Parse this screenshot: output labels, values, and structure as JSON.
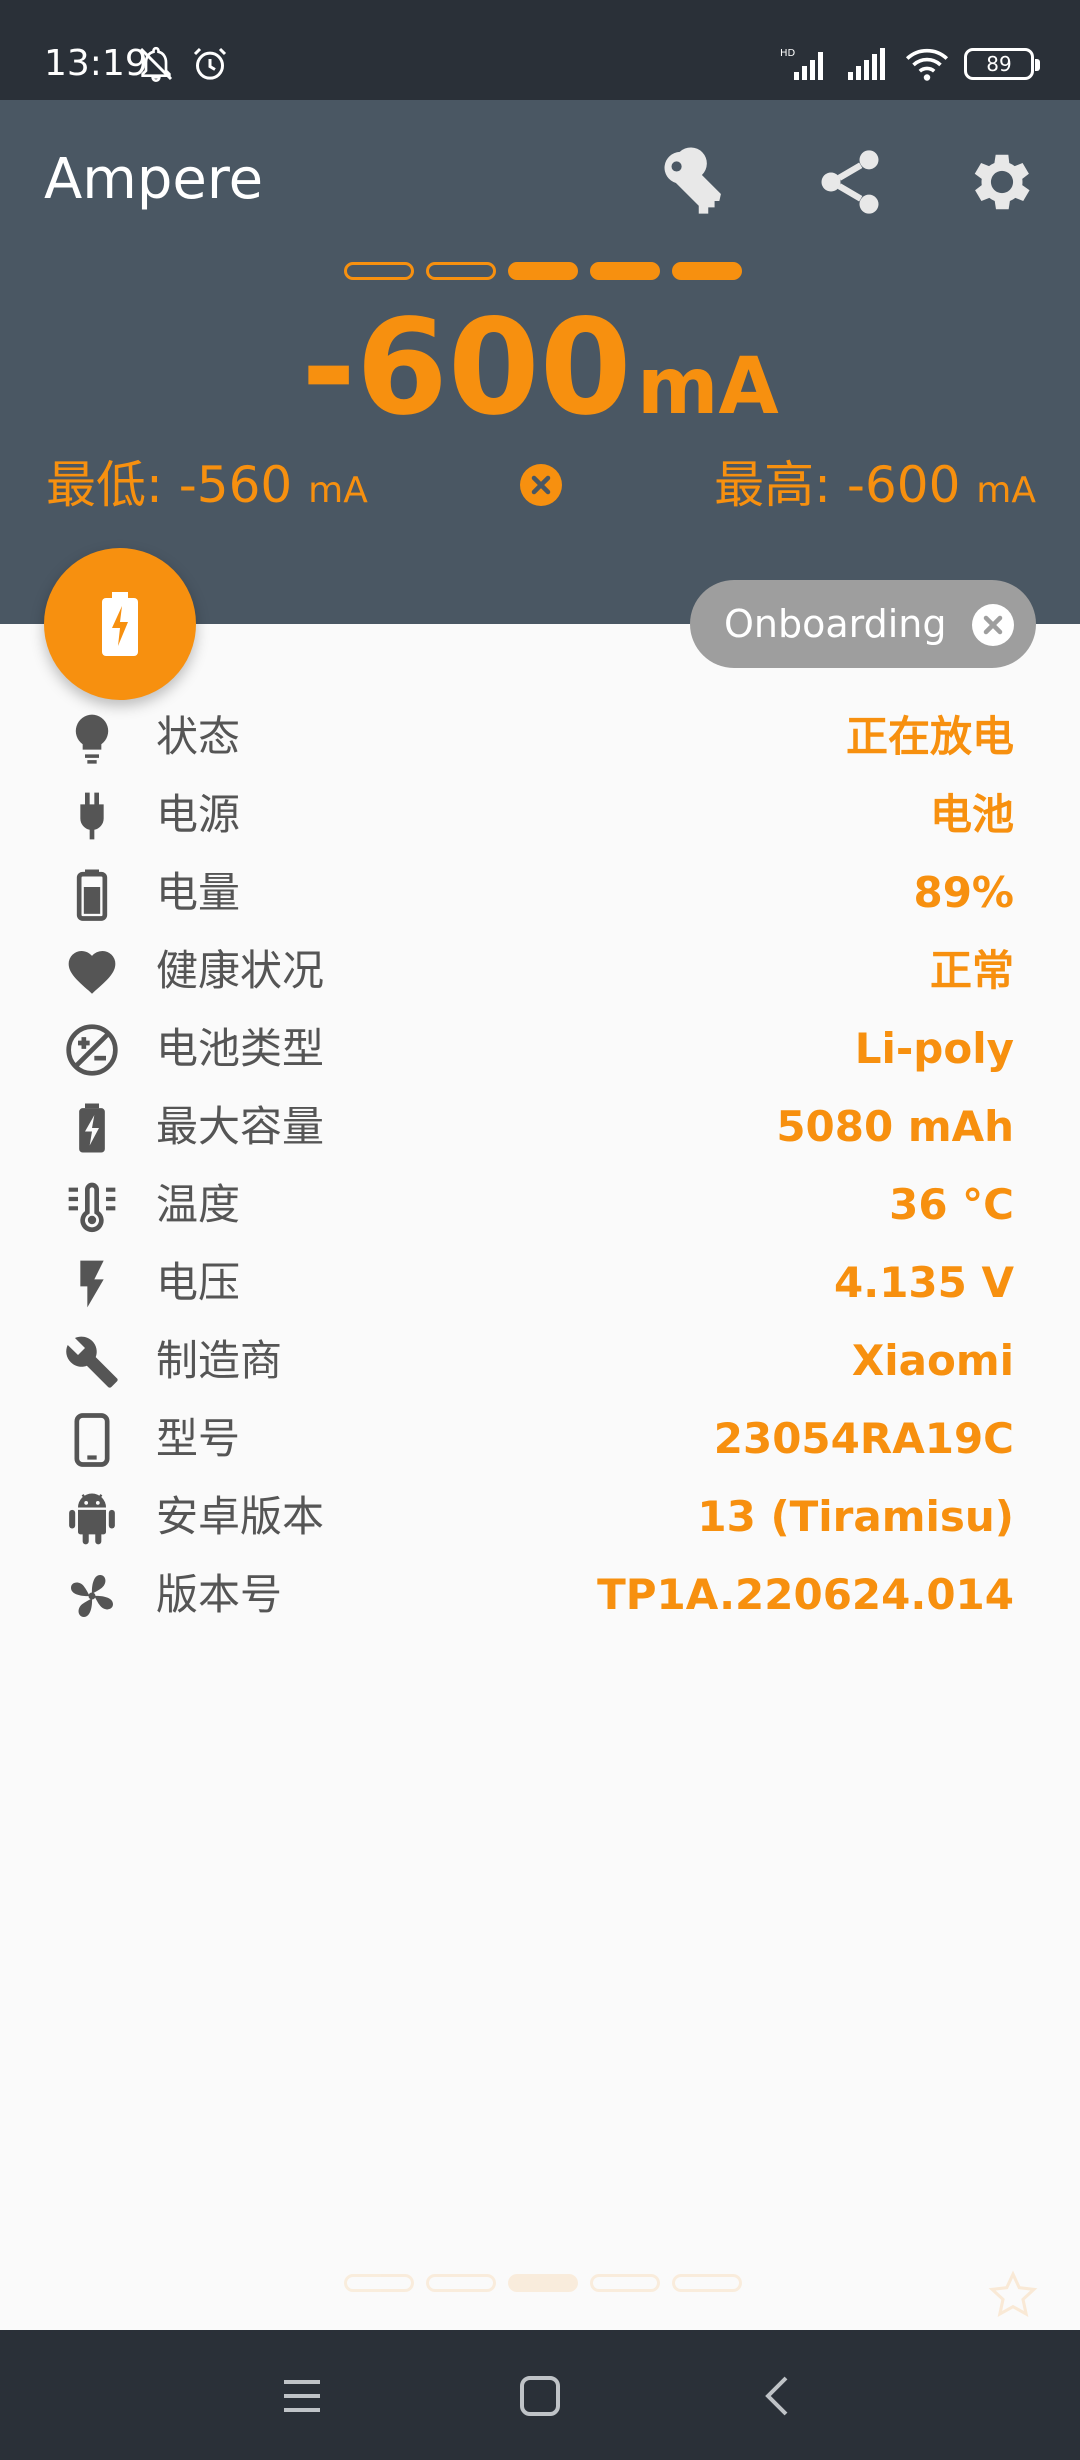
{
  "status_bar": {
    "time": "13:19",
    "battery_level": "89",
    "icons": [
      "bell-off-icon",
      "alarm-icon",
      "hd-signal-icon",
      "signal-icon",
      "wifi-icon"
    ]
  },
  "header": {
    "app_title": "Ampere",
    "actions": [
      "key-icon",
      "share-icon",
      "settings-icon"
    ],
    "level_dashes": {
      "total": 5,
      "filled": 3
    },
    "current_value": "-600",
    "current_unit": "mA",
    "min_label": "最低: -560",
    "max_label": "最高: -600",
    "minmax_unit": "mA"
  },
  "chip": {
    "label": "Onboarding"
  },
  "colors": {
    "accent": "#f7900f",
    "header_bg": "#4a5763",
    "status_bg": "#2a3038",
    "chip_bg": "#9e9e9e",
    "label": "#555555"
  },
  "info": [
    {
      "label": "状态",
      "value": "正在放电",
      "icon": "lightbulb-icon"
    },
    {
      "label": "电源",
      "value": "电池",
      "icon": "plug-icon"
    },
    {
      "label": "电量",
      "value": "89%",
      "icon": "battery-icon"
    },
    {
      "label": "健康状况",
      "value": "正常",
      "icon": "heart-icon"
    },
    {
      "label": "电池类型",
      "value": "Li-poly",
      "icon": "plus-minus-icon"
    },
    {
      "label": "最大容量",
      "value": "5080 mAh",
      "icon": "battery-charging-icon"
    },
    {
      "label": "温度",
      "value": "36 °C",
      "icon": "thermometer-icon"
    },
    {
      "label": "电压",
      "value": "4.135 V",
      "icon": "flash-icon"
    },
    {
      "label": "制造商",
      "value": "Xiaomi",
      "icon": "wrench-icon"
    },
    {
      "label": "型号",
      "value": "23054RA19C",
      "icon": "phone-icon"
    },
    {
      "label": "安卓版本",
      "value": "13 (Tiramisu)",
      "icon": "android-icon"
    },
    {
      "label": "版本号",
      "value": "TP1A.220624.014",
      "icon": "fan-icon"
    }
  ]
}
